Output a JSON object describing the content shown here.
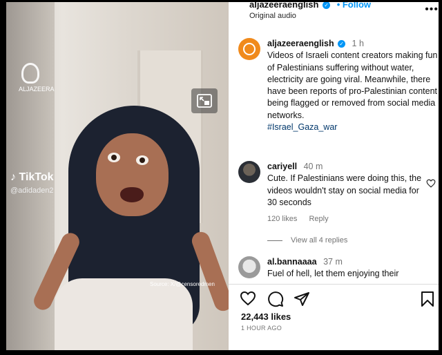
{
  "post": {
    "header": {
      "username": "aljazeeraenglish",
      "verified_mark": "✓",
      "follow_label": "• Follow",
      "audio": "Original audio",
      "more_label": "•••"
    },
    "caption": {
      "username": "aljazeeraenglish",
      "time": "1 h",
      "text": "Videos of Israeli content creators making fun of Palestinians suffering without water, electricity are going viral. Meanwhile, there have been reports of pro-Palestinian content being flagged or removed from social media networks.",
      "hashtag": "#Israel_Gaza_war"
    },
    "comments": [
      {
        "username": "cariyell",
        "time": "40 m",
        "text": "Cute. If Palestinians were doing this, the videos wouldn't stay on social media for 30 seconds",
        "likes": "120 likes",
        "reply_label": "Reply"
      },
      {
        "username": "al.bannaaaa",
        "time": "37 m",
        "text": "Fuel of hell, let them enjoying their"
      }
    ],
    "view_replies": "View all 4 replies",
    "likes_count": "22,443 likes",
    "posted_ago": "1 HOUR AGO"
  },
  "video": {
    "logo_text": "ALJAZEERA",
    "tiktok_label": "TikTok",
    "tiktok_handle": "@adidaden2",
    "source_text": "Source: X/@censoredmen"
  },
  "icons": {
    "heart": "heart-icon",
    "comment": "comment-icon",
    "share": "share-icon",
    "save": "bookmark-icon",
    "pip": "picture-in-picture-icon"
  },
  "colors": {
    "link_blue": "#0095f6",
    "hashtag": "#00376b",
    "aj_orange": "#f08a1c",
    "muted": "#737373"
  }
}
